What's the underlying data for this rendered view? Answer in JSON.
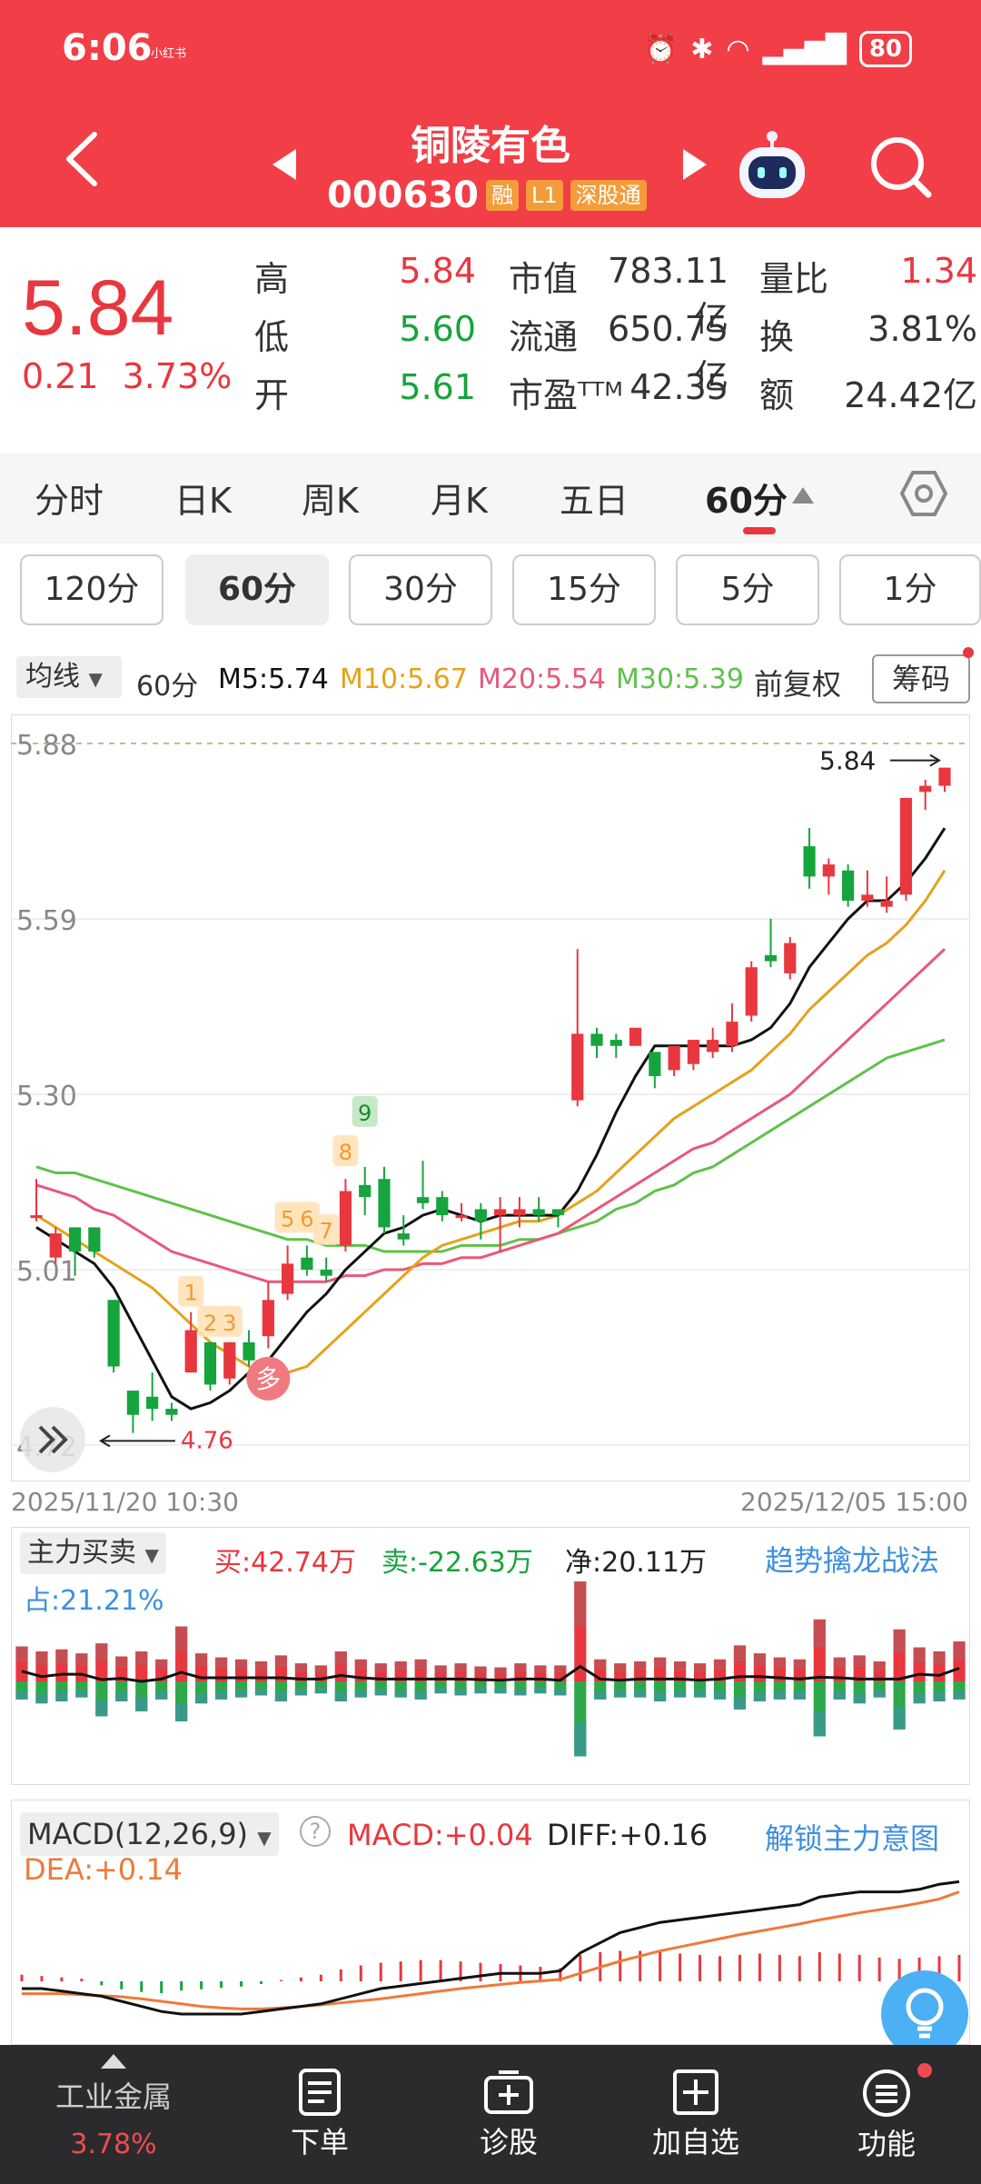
{
  "status": {
    "time": "6:06",
    "small": "小红书",
    "battery": "80"
  },
  "header": {
    "name": "铜陵有色",
    "code": "000630",
    "tags": [
      "融",
      "L1",
      "深股通"
    ]
  },
  "quote": {
    "price": "5.84",
    "change": "0.21",
    "change_pct": "3.73%",
    "high_label": "高",
    "high": "5.84",
    "low_label": "低",
    "low": "5.60",
    "open_label": "开",
    "open": "5.61",
    "mcap_label": "市值",
    "mcap": "783.11亿",
    "float_label": "流通",
    "float": "650.75亿",
    "pe_label": "市盈ᵀᵀᴹ",
    "pe": "42.35",
    "vr_label": "量比",
    "vr": "1.34",
    "turnover_label": "换",
    "turnover": "3.81%",
    "amount_label": "额",
    "amount": "24.42亿"
  },
  "tabs": [
    "分时",
    "日K",
    "周K",
    "月K",
    "五日",
    "60分"
  ],
  "intervals": [
    "120分",
    "60分",
    "30分",
    "15分",
    "5分",
    "1分"
  ],
  "ma": {
    "dropdown": "均线",
    "period": "60分",
    "m5": "M5:5.74",
    "m10": "M10:5.67",
    "m20": "M20:5.54",
    "m30": "M30:5.39",
    "adjust": "前复权",
    "chip": "筹码"
  },
  "kchart_labels": {
    "y_top": "5.88",
    "y_mid": "5.59",
    "y_low": "5.30",
    "y_bottom": "5.01",
    "y_min": "4.72",
    "high_mark": "5.84",
    "low_mark": "4.76",
    "signals": [
      "1",
      "2",
      "3",
      "5",
      "6",
      "7",
      "8",
      "9"
    ],
    "buy_badge": "多"
  },
  "colors": {
    "up": "#e8373e",
    "down": "#16a43c",
    "m5": "#111111",
    "m10": "#e5a21a",
    "m20": "#e8587a",
    "m30": "#5ec24a"
  },
  "dates": {
    "start": "2025/11/20 10:30",
    "end": "2025/12/05 15:00"
  },
  "flow": {
    "title": "主力买卖",
    "buy": "买:42.74万",
    "sell": "卖:-22.63万",
    "net": "净:20.11万",
    "share": "占:21.21%",
    "link": "趋势擒龙战法"
  },
  "macd": {
    "title": "MACD(12,26,9)",
    "macd": "MACD:+0.04",
    "diff": "DIFF:+0.16",
    "dea": "DEA:+0.14",
    "link": "解锁主力意图"
  },
  "bottom_nav": {
    "sector": "工业金属",
    "sector_pct": "3.78%",
    "order": "下单",
    "diagnose": "诊股",
    "watch": "加自选",
    "func": "功能"
  },
  "chart_data": {
    "type": "candlestick",
    "xlabel": "",
    "ylabel": "",
    "ylim": [
      4.72,
      5.88
    ],
    "candles": [
      {
        "o": 5.1,
        "c": 5.1,
        "h": 5.16,
        "l": 5.09
      },
      {
        "o": 5.03,
        "c": 5.07,
        "h": 5.08,
        "l": 5.02
      },
      {
        "o": 5.08,
        "c": 5.04,
        "h": 5.08,
        "l": 5.0
      },
      {
        "o": 5.08,
        "c": 5.04,
        "h": 5.08,
        "l": 5.03
      },
      {
        "o": 4.96,
        "c": 4.85,
        "h": 4.96,
        "l": 4.84
      },
      {
        "o": 4.81,
        "c": 4.77,
        "h": 4.81,
        "l": 4.74
      },
      {
        "o": 4.8,
        "c": 4.78,
        "h": 4.84,
        "l": 4.76
      },
      {
        "o": 4.78,
        "c": 4.77,
        "h": 4.79,
        "l": 4.76
      },
      {
        "o": 4.84,
        "c": 4.91,
        "h": 4.94,
        "l": 4.84
      },
      {
        "o": 4.89,
        "c": 4.82,
        "h": 4.89,
        "l": 4.81
      },
      {
        "o": 4.83,
        "c": 4.89,
        "h": 4.89,
        "l": 4.82
      },
      {
        "o": 4.89,
        "c": 4.86,
        "h": 4.91,
        "l": 4.85
      },
      {
        "o": 4.9,
        "c": 4.96,
        "h": 4.99,
        "l": 4.88
      },
      {
        "o": 4.97,
        "c": 5.02,
        "h": 5.05,
        "l": 4.96
      },
      {
        "o": 5.03,
        "c": 5.01,
        "h": 5.05,
        "l": 5.0
      },
      {
        "o": 5.01,
        "c": 5.0,
        "h": 5.03,
        "l": 4.99
      },
      {
        "o": 5.05,
        "c": 5.14,
        "h": 5.16,
        "l": 5.04
      },
      {
        "o": 5.15,
        "c": 5.13,
        "h": 5.18,
        "l": 5.1
      },
      {
        "o": 5.16,
        "c": 5.08,
        "h": 5.18,
        "l": 5.07
      },
      {
        "o": 5.07,
        "c": 5.06,
        "h": 5.1,
        "l": 5.05
      },
      {
        "o": 5.13,
        "c": 5.12,
        "h": 5.19,
        "l": 5.11
      },
      {
        "o": 5.13,
        "c": 5.1,
        "h": 5.14,
        "l": 5.09
      },
      {
        "o": 5.1,
        "c": 5.1,
        "h": 5.12,
        "l": 5.09
      },
      {
        "o": 5.11,
        "c": 5.09,
        "h": 5.12,
        "l": 5.06
      },
      {
        "o": 5.1,
        "c": 5.11,
        "h": 5.13,
        "l": 5.04
      },
      {
        "o": 5.1,
        "c": 5.11,
        "h": 5.13,
        "l": 5.08
      },
      {
        "o": 5.11,
        "c": 5.1,
        "h": 5.13,
        "l": 5.09
      },
      {
        "o": 5.11,
        "c": 5.1,
        "h": 5.11,
        "l": 5.08
      },
      {
        "o": 5.29,
        "c": 5.4,
        "h": 5.54,
        "l": 5.28
      },
      {
        "o": 5.4,
        "c": 5.38,
        "h": 5.41,
        "l": 5.36
      },
      {
        "o": 5.39,
        "c": 5.38,
        "h": 5.4,
        "l": 5.36
      },
      {
        "o": 5.38,
        "c": 5.41,
        "h": 5.41,
        "l": 5.38
      },
      {
        "o": 5.37,
        "c": 5.33,
        "h": 5.37,
        "l": 5.31
      },
      {
        "o": 5.34,
        "c": 5.38,
        "h": 5.38,
        "l": 5.33
      },
      {
        "o": 5.35,
        "c": 5.39,
        "h": 5.39,
        "l": 5.34
      },
      {
        "o": 5.37,
        "c": 5.39,
        "h": 5.41,
        "l": 5.36
      },
      {
        "o": 5.38,
        "c": 5.42,
        "h": 5.45,
        "l": 5.37
      },
      {
        "o": 5.43,
        "c": 5.51,
        "h": 5.52,
        "l": 5.42
      },
      {
        "o": 5.53,
        "c": 5.52,
        "h": 5.59,
        "l": 5.51
      },
      {
        "o": 5.5,
        "c": 5.55,
        "h": 5.56,
        "l": 5.49
      },
      {
        "o": 5.71,
        "c": 5.66,
        "h": 5.74,
        "l": 5.64
      },
      {
        "o": 5.66,
        "c": 5.68,
        "h": 5.69,
        "l": 5.63
      },
      {
        "o": 5.67,
        "c": 5.62,
        "h": 5.68,
        "l": 5.61
      },
      {
        "o": 5.62,
        "c": 5.63,
        "h": 5.67,
        "l": 5.61
      },
      {
        "o": 5.61,
        "c": 5.62,
        "h": 5.66,
        "l": 5.6
      },
      {
        "o": 5.63,
        "c": 5.79,
        "h": 5.79,
        "l": 5.62
      },
      {
        "o": 5.8,
        "c": 5.81,
        "h": 5.82,
        "l": 5.77
      },
      {
        "o": 5.81,
        "c": 5.84,
        "h": 5.84,
        "l": 5.8
      }
    ],
    "ma5": [
      5.08,
      5.06,
      5.04,
      5.02,
      4.98,
      4.92,
      4.86,
      4.8,
      4.78,
      4.79,
      4.81,
      4.84,
      4.86,
      4.9,
      4.94,
      4.97,
      5.01,
      5.04,
      5.07,
      5.08,
      5.1,
      5.11,
      5.1,
      5.09,
      5.1,
      5.1,
      5.1,
      5.1,
      5.14,
      5.2,
      5.27,
      5.33,
      5.38,
      5.38,
      5.38,
      5.38,
      5.38,
      5.39,
      5.41,
      5.45,
      5.51,
      5.55,
      5.59,
      5.62,
      5.62,
      5.65,
      5.69,
      5.74
    ],
    "ma10": [
      5.1,
      5.08,
      5.06,
      5.04,
      5.02,
      5.0,
      4.98,
      4.95,
      4.92,
      4.89,
      4.87,
      4.85,
      4.83,
      4.84,
      4.85,
      4.88,
      4.91,
      4.94,
      4.97,
      5.0,
      5.03,
      5.05,
      5.06,
      5.07,
      5.08,
      5.09,
      5.09,
      5.1,
      5.12,
      5.14,
      5.17,
      5.2,
      5.23,
      5.26,
      5.28,
      5.3,
      5.32,
      5.34,
      5.37,
      5.4,
      5.44,
      5.47,
      5.5,
      5.53,
      5.55,
      5.58,
      5.62,
      5.67
    ],
    "ma20": [
      5.15,
      5.14,
      5.13,
      5.11,
      5.1,
      5.08,
      5.06,
      5.04,
      5.03,
      5.02,
      5.01,
      5.0,
      4.99,
      4.99,
      4.99,
      4.99,
      5.0,
      5.0,
      5.01,
      5.01,
      5.02,
      5.02,
      5.03,
      5.03,
      5.04,
      5.05,
      5.06,
      5.07,
      5.09,
      5.11,
      5.13,
      5.15,
      5.17,
      5.19,
      5.21,
      5.22,
      5.24,
      5.26,
      5.28,
      5.3,
      5.33,
      5.36,
      5.39,
      5.42,
      5.45,
      5.48,
      5.51,
      5.54
    ],
    "ma30": [
      5.18,
      5.17,
      5.17,
      5.16,
      5.15,
      5.14,
      5.13,
      5.12,
      5.11,
      5.1,
      5.09,
      5.08,
      5.07,
      5.06,
      5.06,
      5.05,
      5.05,
      5.05,
      5.04,
      5.04,
      5.04,
      5.04,
      5.05,
      5.05,
      5.05,
      5.06,
      5.06,
      5.07,
      5.08,
      5.09,
      5.11,
      5.12,
      5.14,
      5.15,
      5.17,
      5.18,
      5.2,
      5.22,
      5.24,
      5.26,
      5.28,
      5.3,
      5.32,
      5.34,
      5.36,
      5.37,
      5.38,
      5.39
    ],
    "flow_buy": [
      0.35,
      0.3,
      0.32,
      0.28,
      0.38,
      0.25,
      0.3,
      0.22,
      0.55,
      0.28,
      0.24,
      0.22,
      0.2,
      0.26,
      0.18,
      0.16,
      0.3,
      0.22,
      0.18,
      0.2,
      0.22,
      0.16,
      0.18,
      0.15,
      0.14,
      0.18,
      0.16,
      0.16,
      1.0,
      0.22,
      0.18,
      0.2,
      0.24,
      0.2,
      0.18,
      0.22,
      0.36,
      0.28,
      0.24,
      0.22,
      0.62,
      0.24,
      0.26,
      0.2,
      0.52,
      0.34,
      0.3,
      0.4
    ],
    "flow_sell": [
      0.18,
      0.22,
      0.2,
      0.16,
      0.35,
      0.2,
      0.3,
      0.18,
      0.4,
      0.22,
      0.18,
      0.16,
      0.14,
      0.2,
      0.14,
      0.12,
      0.2,
      0.16,
      0.14,
      0.16,
      0.18,
      0.12,
      0.14,
      0.12,
      0.12,
      0.14,
      0.12,
      0.14,
      0.75,
      0.18,
      0.16,
      0.16,
      0.2,
      0.16,
      0.16,
      0.18,
      0.28,
      0.2,
      0.18,
      0.18,
      0.55,
      0.18,
      0.22,
      0.16,
      0.48,
      0.22,
      0.2,
      0.18
    ],
    "macd_hist": [
      0.01,
      0.008,
      0.006,
      0.004,
      -0.006,
      -0.012,
      -0.016,
      -0.018,
      -0.014,
      -0.012,
      -0.01,
      -0.008,
      -0.004,
      0.002,
      0.006,
      0.01,
      0.018,
      0.024,
      0.028,
      0.03,
      0.032,
      0.032,
      0.03,
      0.028,
      0.026,
      0.024,
      0.022,
      0.02,
      0.04,
      0.044,
      0.046,
      0.046,
      0.044,
      0.042,
      0.04,
      0.038,
      0.04,
      0.042,
      0.04,
      0.038,
      0.044,
      0.042,
      0.04,
      0.036,
      0.034,
      0.036,
      0.038,
      0.04
    ],
    "diff": [
      -0.05,
      -0.05,
      -0.055,
      -0.06,
      -0.065,
      -0.075,
      -0.085,
      -0.095,
      -0.1,
      -0.1,
      -0.1,
      -0.1,
      -0.095,
      -0.09,
      -0.085,
      -0.08,
      -0.07,
      -0.06,
      -0.05,
      -0.045,
      -0.04,
      -0.035,
      -0.03,
      -0.025,
      -0.02,
      -0.02,
      -0.02,
      -0.015,
      0.02,
      0.04,
      0.06,
      0.07,
      0.08,
      0.085,
      0.09,
      0.095,
      0.1,
      0.105,
      0.11,
      0.115,
      0.13,
      0.135,
      0.14,
      0.14,
      0.14,
      0.145,
      0.155,
      0.16
    ],
    "dea": [
      -0.06,
      -0.06,
      -0.06,
      -0.062,
      -0.064,
      -0.066,
      -0.07,
      -0.075,
      -0.08,
      -0.085,
      -0.088,
      -0.09,
      -0.09,
      -0.088,
      -0.085,
      -0.082,
      -0.078,
      -0.074,
      -0.07,
      -0.065,
      -0.06,
      -0.055,
      -0.05,
      -0.046,
      -0.042,
      -0.038,
      -0.035,
      -0.032,
      -0.02,
      -0.008,
      0.004,
      0.014,
      0.024,
      0.032,
      0.04,
      0.048,
      0.056,
      0.063,
      0.07,
      0.077,
      0.085,
      0.092,
      0.099,
      0.105,
      0.111,
      0.118,
      0.126,
      0.14
    ]
  }
}
